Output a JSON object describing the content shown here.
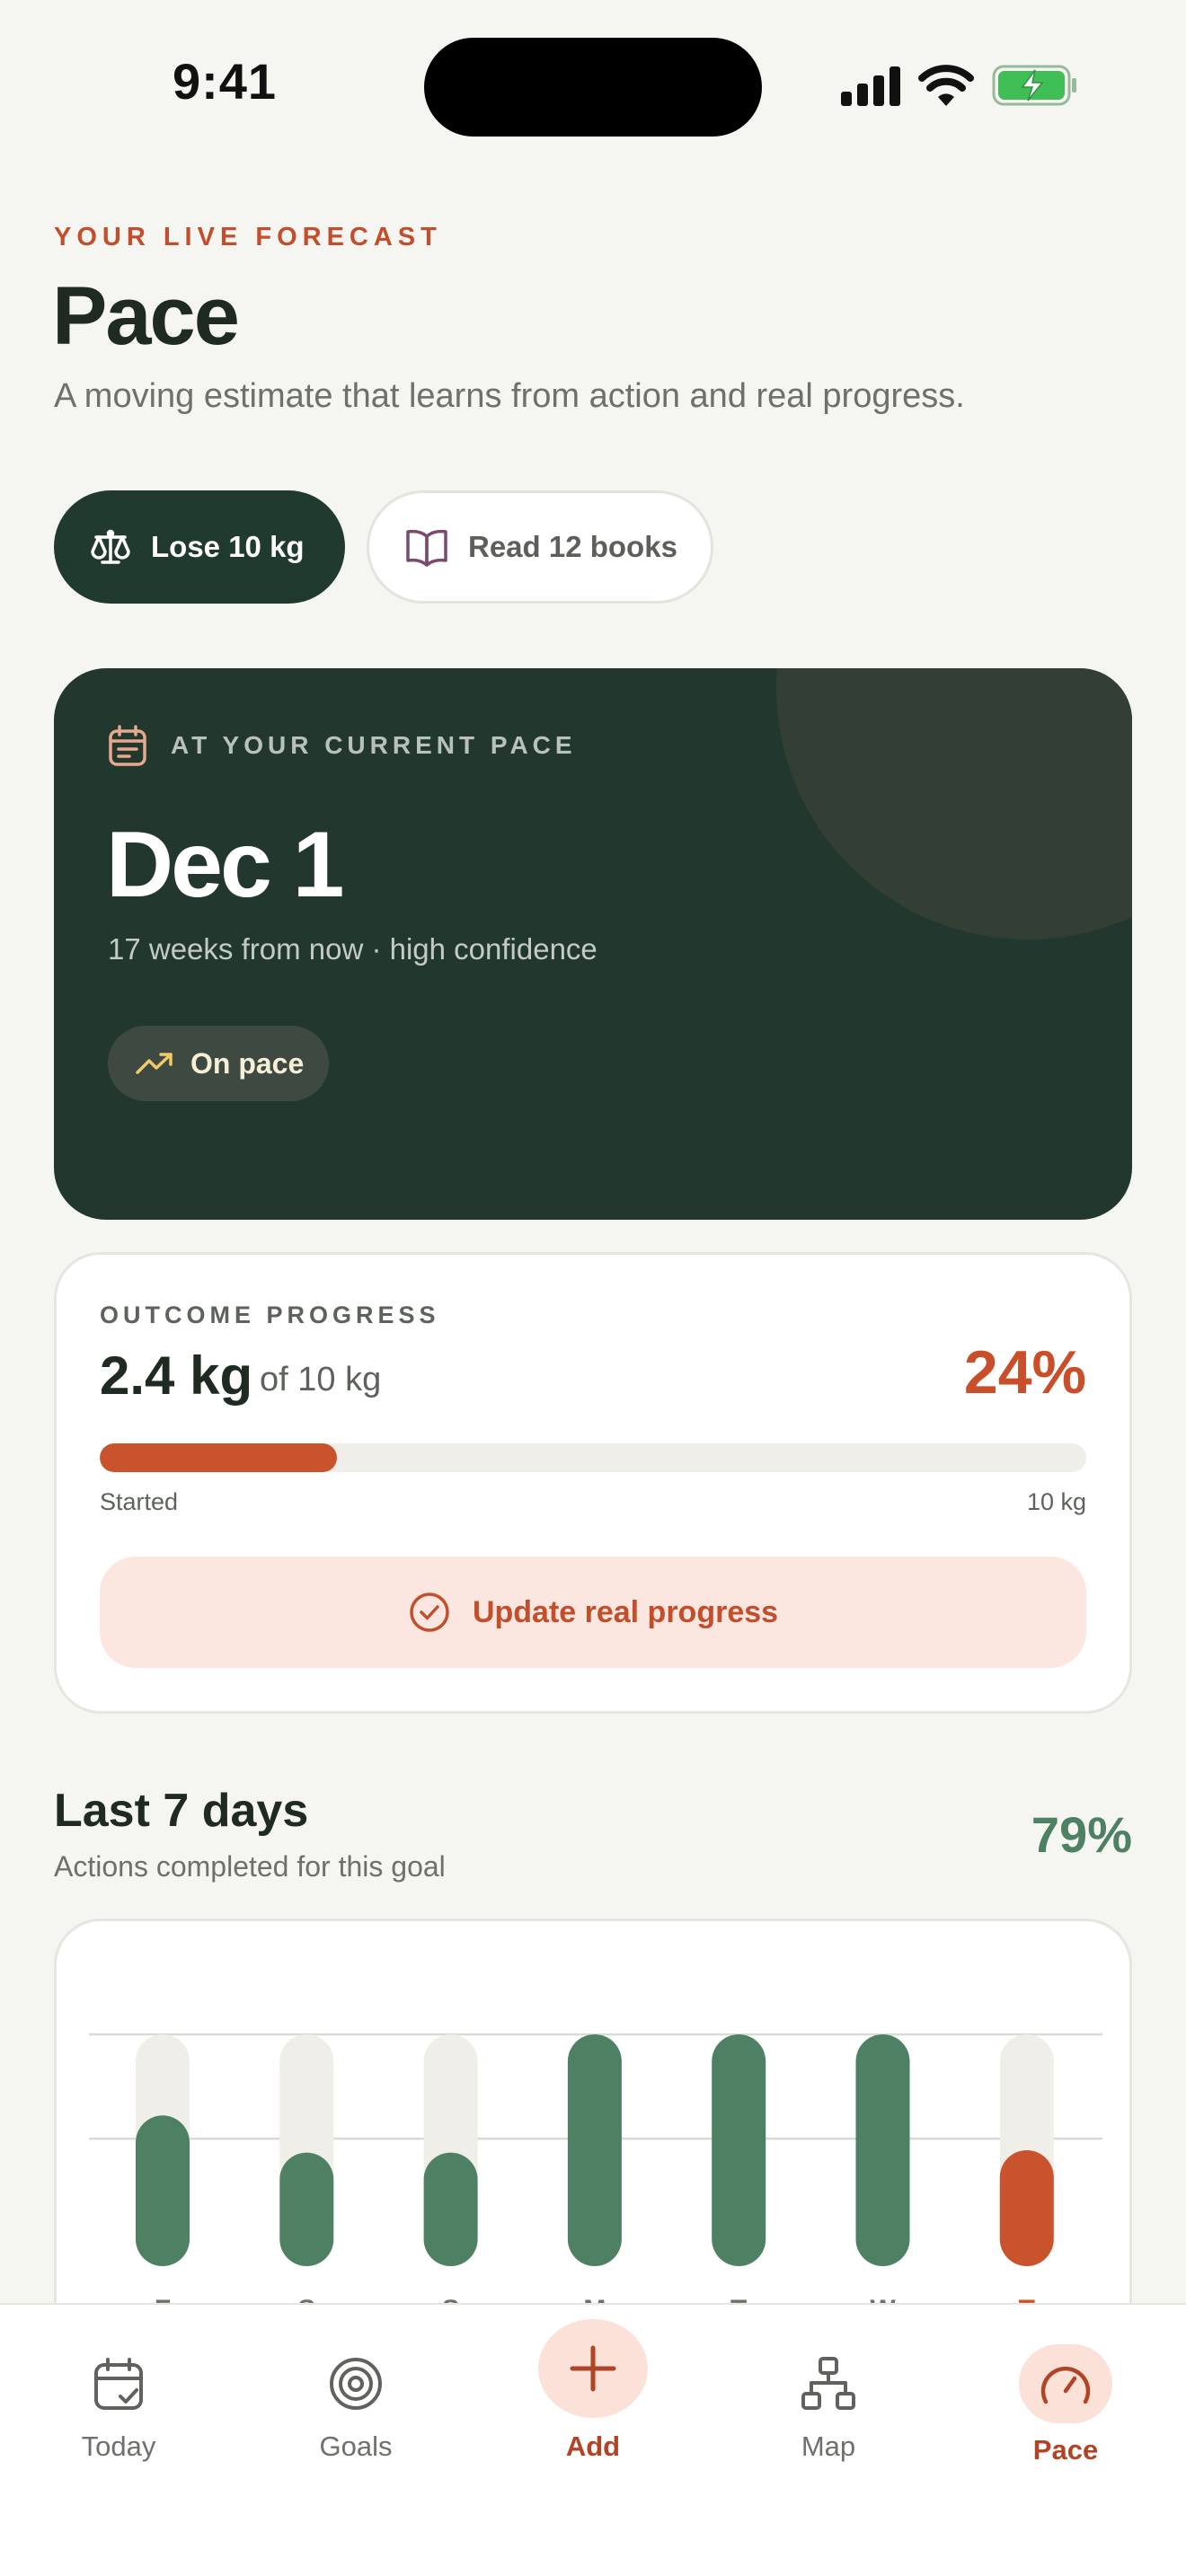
{
  "status_bar": {
    "time": "9:41"
  },
  "header": {
    "eyebrow": "YOUR LIVE FORECAST",
    "title": "Pace",
    "subtitle": "A moving estimate that learns from action and real progress."
  },
  "goal_chips": [
    {
      "label": "Lose 10 kg",
      "icon": "scale-icon",
      "selected": true
    },
    {
      "label": "Read 12 books",
      "icon": "book-icon",
      "selected": false
    }
  ],
  "forecast": {
    "label": "AT YOUR CURRENT PACE",
    "date": "Dec 1",
    "subtitle": "17 weeks from now · high confidence",
    "badge": "On pace"
  },
  "outcome": {
    "label": "OUTCOME PROGRESS",
    "value": "2.4 kg",
    "of_text": "of 10 kg",
    "percent_text": "24%",
    "progress_fraction": 0.24,
    "start_label": "Started",
    "end_label": "10 kg",
    "button_label": "Update real progress"
  },
  "week": {
    "title": "Last 7 days",
    "subtitle": "Actions completed for this goal",
    "percent_text": "79%"
  },
  "chart_data": {
    "type": "bar",
    "categories": [
      "F",
      "S",
      "S",
      "M",
      "T",
      "W",
      "T"
    ],
    "values": [
      0.65,
      0.49,
      0.49,
      1.0,
      1.0,
      1.0,
      0.5
    ],
    "highlight_index": 6,
    "ylim": [
      0,
      1
    ],
    "grid": true,
    "colors": {
      "done": "#4E8164",
      "today": "#C9532D",
      "track": "#EFEEE9"
    }
  },
  "tabs": [
    {
      "label": "Today",
      "icon": "calendar-check-icon",
      "active": false
    },
    {
      "label": "Goals",
      "icon": "target-icon",
      "active": false
    },
    {
      "label": "Add",
      "icon": "plus-icon",
      "active": false
    },
    {
      "label": "Map",
      "icon": "map-network-icon",
      "active": false
    },
    {
      "label": "Pace",
      "icon": "speedometer-icon",
      "active": true
    }
  ],
  "colors": {
    "accent": "#C44E2C",
    "dark_green": "#213A2F",
    "success": "#4E8163",
    "background": "#F5F5F1"
  }
}
